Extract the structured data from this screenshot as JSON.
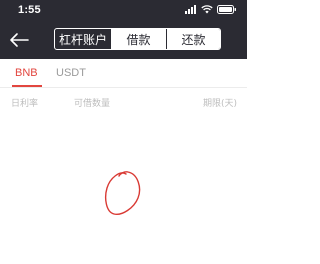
{
  "status_bar": {
    "time": "1:55"
  },
  "nav": {
    "back_icon": "arrow-left-icon",
    "segments": [
      {
        "label": "杠杆账户",
        "selected": false
      },
      {
        "label": "借款",
        "selected": true
      },
      {
        "label": "还款",
        "selected": false
      }
    ]
  },
  "tabs": [
    {
      "label": "BNB",
      "active": true
    },
    {
      "label": "USDT",
      "active": false
    }
  ],
  "table": {
    "headers": [
      "日利率",
      "可借数量",
      "期限(天)"
    ]
  },
  "colors": {
    "header_bg": "#2b2b33",
    "accent": "#e2463f"
  }
}
